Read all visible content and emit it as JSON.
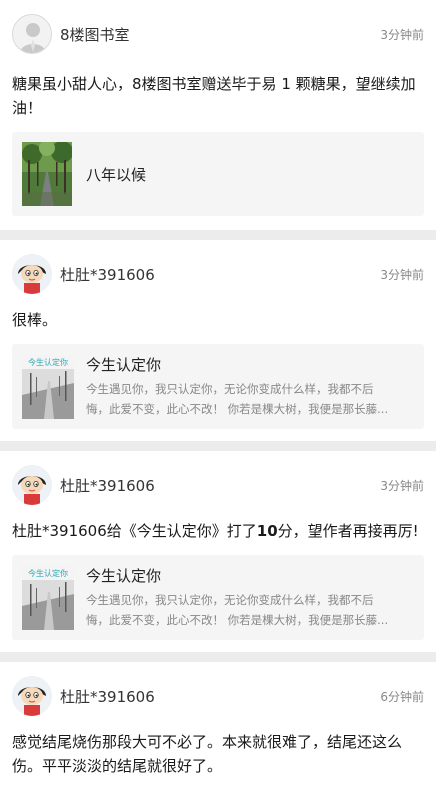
{
  "posts": [
    {
      "user": "8楼图书室",
      "time": "3分钟前",
      "text_parts": [
        "糖果虽小甜人心，8楼图书室赠送毕于易 1 颗糖果，望继续加油！"
      ],
      "ref": {
        "title": "八年以候",
        "desc_line1": "",
        "desc_line2": ""
      }
    },
    {
      "user": "杜肚*391606",
      "time": "3分钟前",
      "text_parts": [
        "很棒。"
      ],
      "ref": {
        "title": "今生认定你",
        "desc_line1": "今生遇见你，我只认定你，无论你变成什么样，我都不后",
        "desc_line2": "悔，此爱不变，此心不改！ 你若是棵大树，我便是那长藤..."
      }
    },
    {
      "user": "杜肚*391606",
      "time": "3分钟前",
      "text_before": "杜肚*391606给《今生认定你》打了",
      "text_score": "10",
      "text_after": "分，望作者再接再厉!",
      "ref": {
        "title": "今生认定你",
        "desc_line1": "今生遇见你，我只认定你，无论你变成什么样，我都不后",
        "desc_line2": "悔，此爱不变，此心不改！ 你若是棵大树，我便是那长藤..."
      }
    },
    {
      "user": "杜肚*391606",
      "time": "6分钟前",
      "text_parts": [
        "感觉结尾烧伤那段大可不必了。本来就很难了，结尾还这么伤。平平淡淡的结尾就很好了。"
      ]
    }
  ],
  "cover_caption": "今生认定你"
}
